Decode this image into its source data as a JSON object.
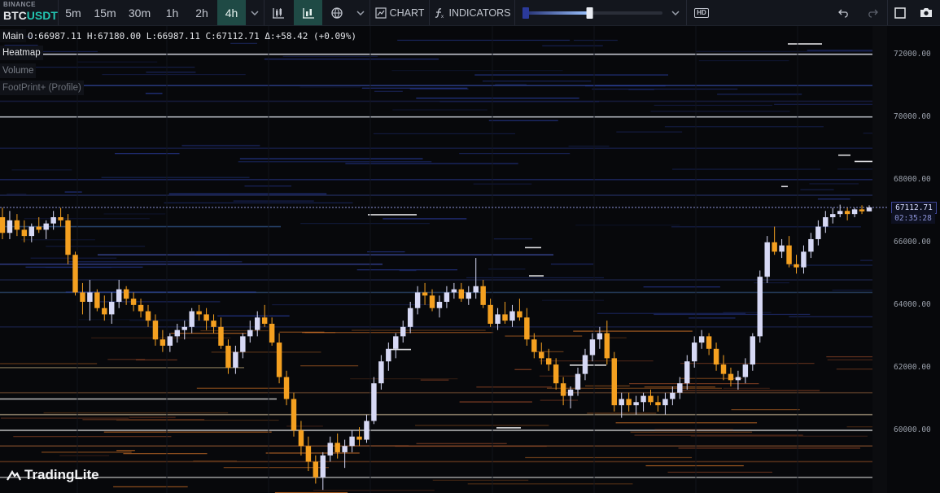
{
  "toolbar": {
    "exchange": "BINANCE",
    "symbol_base": "BTC",
    "symbol_quote": "USDT",
    "timeframes": [
      {
        "label": "5m",
        "active": false
      },
      {
        "label": "15m",
        "active": false
      },
      {
        "label": "30m",
        "active": false
      },
      {
        "label": "1h",
        "active": false
      },
      {
        "label": "2h",
        "active": false
      },
      {
        "label": "4h",
        "active": true
      }
    ],
    "chart_label": "CHART",
    "indicators_label": "INDICATORS",
    "hd_label": "HD",
    "heatmap_slider_value": 0.48,
    "icons": [
      "candle-type-icon",
      "area-chart-icon",
      "globe-icon",
      "chart-icon",
      "function-icon",
      "undo-icon",
      "redo-icon",
      "fullscreen-icon",
      "camera-icon"
    ]
  },
  "legend": {
    "pane": "Main",
    "ohlc": "O:66987.11 H:67180.00 L:66987.11 C:67112.71 Δ:+58.42 (+0.09%)"
  },
  "panes": [
    "Heatmap",
    "Volume",
    "FootPrint+ (Profile)"
  ],
  "last_price": "67112.71",
  "countdown": "02:35:28",
  "brand": "TradingLite",
  "colors": {
    "bull": "#d7d9f5",
    "bear": "#f4a020",
    "accent": "#23c3b0"
  },
  "chart_data": {
    "type": "candlestick",
    "y_ticks": [
      "72000.00",
      "70000.00",
      "68000.00",
      "66000.00",
      "64000.00",
      "62000.00",
      "60000.00"
    ],
    "ylim": [
      58000,
      72900
    ],
    "last": 67112.71,
    "candles": [
      [
        66800,
        67100,
        66100,
        66300
      ],
      [
        66300,
        67000,
        66100,
        66700
      ],
      [
        66700,
        66900,
        66200,
        66400
      ],
      [
        66400,
        66700,
        66000,
        66200
      ],
      [
        66200,
        66600,
        66000,
        66500
      ],
      [
        66500,
        66800,
        66300,
        66400
      ],
      [
        66400,
        66700,
        66100,
        66600
      ],
      [
        66600,
        67000,
        66400,
        66800
      ],
      [
        66800,
        67100,
        66500,
        66700
      ],
      [
        66700,
        66900,
        65300,
        65600
      ],
      [
        65600,
        65700,
        64300,
        64400
      ],
      [
        64400,
        64700,
        63700,
        64100
      ],
      [
        64100,
        64800,
        63500,
        64400
      ],
      [
        64400,
        64500,
        63800,
        63900
      ],
      [
        63900,
        64300,
        63500,
        63700
      ],
      [
        63700,
        64400,
        63400,
        64100
      ],
      [
        64100,
        64800,
        63900,
        64500
      ],
      [
        64500,
        64600,
        64000,
        64200
      ],
      [
        64200,
        64400,
        63800,
        64000
      ],
      [
        64000,
        64200,
        63600,
        63800
      ],
      [
        63800,
        64000,
        63300,
        63500
      ],
      [
        63500,
        63700,
        62700,
        62900
      ],
      [
        62900,
        63200,
        62500,
        62700
      ],
      [
        62700,
        63100,
        62500,
        63000
      ],
      [
        63000,
        63400,
        62800,
        63200
      ],
      [
        63200,
        63500,
        62900,
        63300
      ],
      [
        63300,
        63900,
        63100,
        63800
      ],
      [
        63800,
        64000,
        63500,
        63700
      ],
      [
        63700,
        63900,
        63200,
        63500
      ],
      [
        63500,
        63700,
        63100,
        63300
      ],
      [
        63300,
        63600,
        62600,
        62700
      ],
      [
        62700,
        62900,
        61800,
        62000
      ],
      [
        62000,
        62700,
        61800,
        62500
      ],
      [
        62500,
        63100,
        62300,
        63000
      ],
      [
        63000,
        63500,
        62800,
        63200
      ],
      [
        63200,
        63800,
        63000,
        63600
      ],
      [
        63600,
        64000,
        63300,
        63400
      ],
      [
        63400,
        63600,
        62700,
        62800
      ],
      [
        62800,
        63100,
        61500,
        61700
      ],
      [
        61700,
        61900,
        60800,
        61000
      ],
      [
        61000,
        61200,
        59800,
        60000
      ],
      [
        60000,
        60300,
        59200,
        59500
      ],
      [
        59500,
        59800,
        58700,
        59000
      ],
      [
        59000,
        59200,
        58300,
        58500
      ],
      [
        58500,
        59300,
        58100,
        59200
      ],
      [
        59200,
        59800,
        59000,
        59600
      ],
      [
        59600,
        59900,
        59100,
        59300
      ],
      [
        59300,
        59700,
        58800,
        59500
      ],
      [
        59500,
        60000,
        59300,
        59800
      ],
      [
        59800,
        60100,
        59500,
        59700
      ],
      [
        59700,
        60500,
        59600,
        60300
      ],
      [
        60300,
        61700,
        60200,
        61500
      ],
      [
        61500,
        62400,
        61300,
        62200
      ],
      [
        62200,
        62800,
        61900,
        62600
      ],
      [
        62600,
        63100,
        62300,
        63000
      ],
      [
        63000,
        63500,
        62800,
        63300
      ],
      [
        63300,
        64100,
        63100,
        63900
      ],
      [
        63900,
        64600,
        63700,
        64400
      ],
      [
        64400,
        64700,
        64000,
        64300
      ],
      [
        64300,
        64500,
        63800,
        63900
      ],
      [
        63900,
        64300,
        63600,
        64100
      ],
      [
        64100,
        64600,
        63900,
        64400
      ],
      [
        64400,
        64700,
        64200,
        64500
      ],
      [
        64500,
        64700,
        64100,
        64200
      ],
      [
        64200,
        64600,
        64000,
        64400
      ],
      [
        64400,
        65500,
        64200,
        64600
      ],
      [
        64600,
        64800,
        63900,
        64000
      ],
      [
        64000,
        64200,
        63300,
        63400
      ],
      [
        63400,
        63900,
        63200,
        63700
      ],
      [
        63700,
        64100,
        63400,
        63500
      ],
      [
        63500,
        64000,
        63300,
        63800
      ],
      [
        63800,
        64200,
        63500,
        63600
      ],
      [
        63600,
        63900,
        62700,
        62900
      ],
      [
        62900,
        63100,
        62300,
        62500
      ],
      [
        62500,
        62800,
        62100,
        62300
      ],
      [
        62300,
        62600,
        61900,
        62100
      ],
      [
        62100,
        62300,
        61300,
        61500
      ],
      [
        61500,
        61700,
        60800,
        61100
      ],
      [
        61100,
        61400,
        60700,
        61300
      ],
      [
        61300,
        62000,
        61100,
        61800
      ],
      [
        61800,
        62600,
        61600,
        62400
      ],
      [
        62400,
        63100,
        62200,
        62900
      ],
      [
        62900,
        63300,
        62600,
        63100
      ],
      [
        63100,
        63500,
        62100,
        62300
      ],
      [
        62300,
        62500,
        60600,
        60800
      ],
      [
        60800,
        61200,
        60400,
        61000
      ],
      [
        61000,
        61200,
        60600,
        60800
      ],
      [
        60800,
        61100,
        60500,
        60900
      ],
      [
        60900,
        61200,
        60600,
        61100
      ],
      [
        61100,
        61300,
        60800,
        60900
      ],
      [
        60900,
        61100,
        60600,
        60800
      ],
      [
        60800,
        61200,
        60500,
        61000
      ],
      [
        61000,
        61400,
        60800,
        61200
      ],
      [
        61200,
        61700,
        61000,
        61500
      ],
      [
        61500,
        62400,
        61300,
        62200
      ],
      [
        62200,
        63000,
        62000,
        62800
      ],
      [
        62800,
        63200,
        62600,
        63000
      ],
      [
        63000,
        63100,
        62400,
        62600
      ],
      [
        62600,
        62800,
        61900,
        62100
      ],
      [
        62100,
        62400,
        61600,
        61800
      ],
      [
        61800,
        62000,
        61400,
        61600
      ],
      [
        61600,
        61900,
        61300,
        61700
      ],
      [
        61700,
        62300,
        61500,
        62100
      ],
      [
        62100,
        63100,
        61900,
        63000
      ],
      [
        63000,
        65100,
        62800,
        64900
      ],
      [
        64900,
        66200,
        64700,
        66000
      ],
      [
        66000,
        66500,
        65600,
        65700
      ],
      [
        65700,
        66100,
        65500,
        65900
      ],
      [
        65900,
        66200,
        65200,
        65300
      ],
      [
        65300,
        65600,
        65000,
        65200
      ],
      [
        65200,
        65900,
        65000,
        65700
      ],
      [
        65700,
        66300,
        65500,
        66100
      ],
      [
        66100,
        66700,
        65900,
        66500
      ],
      [
        66500,
        67000,
        66300,
        66800
      ],
      [
        66800,
        67100,
        66600,
        66900
      ],
      [
        66900,
        67200,
        66800,
        67000
      ],
      [
        67000,
        67100,
        66700,
        66900
      ],
      [
        66900,
        67100,
        66800,
        67050
      ],
      [
        67050,
        67180,
        66900,
        66987
      ],
      [
        66987,
        67180,
        66987,
        67112
      ]
    ]
  }
}
